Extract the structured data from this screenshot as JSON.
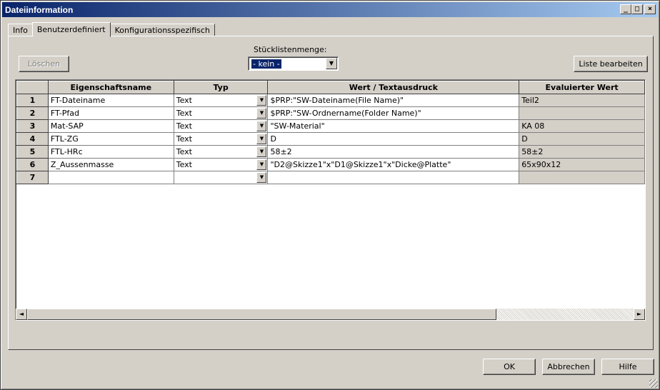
{
  "window": {
    "title": "Dateiinformation",
    "buttons": {
      "minimize": "_",
      "maximize": "□",
      "close": "×"
    }
  },
  "tabs": [
    {
      "label": "Info",
      "active": false
    },
    {
      "label": "Benutzerdefiniert",
      "active": true
    },
    {
      "label": "Konfigurationsspezifisch",
      "active": false
    }
  ],
  "toolbar": {
    "delete_label": "Löschen",
    "edit_list_label": "Liste bearbeiten"
  },
  "bom": {
    "label": "Stücklistenmenge:",
    "value": "- kein -"
  },
  "grid": {
    "headers": [
      "Eigenschaftsname",
      "Typ",
      "Wert / Textausdruck",
      "Evaluierter Wert"
    ],
    "rows": [
      {
        "num": "1",
        "name": "FT-Dateiname",
        "type": "Text",
        "value": "$PRP:\"SW-Dateiname(File Name)\"",
        "evaluated": "Teil2"
      },
      {
        "num": "2",
        "name": "FT-Pfad",
        "type": "Text",
        "value": "$PRP:\"SW-Ordnername(Folder Name)\"",
        "evaluated": ""
      },
      {
        "num": "3",
        "name": "Mat-SAP",
        "type": "Text",
        "value": "\"SW-Material\"",
        "evaluated": "KA 08"
      },
      {
        "num": "4",
        "name": "FTL-ZG",
        "type": "Text",
        "value": "D",
        "evaluated": "D"
      },
      {
        "num": "5",
        "name": "FTL-HRc",
        "type": "Text",
        "value": "58±2",
        "evaluated": "58±2"
      },
      {
        "num": "6",
        "name": "Z_Aussenmasse",
        "type": "Text",
        "value": "\"D2@Skizze1\"x\"D1@Skizze1\"x\"Dicke@Platte\"",
        "evaluated": "65x90x12"
      },
      {
        "num": "7",
        "name": "",
        "type": "",
        "value": "",
        "evaluated": ""
      }
    ]
  },
  "footer": {
    "ok_label": "OK",
    "cancel_label": "Abbrechen",
    "help_label": "Hilfe"
  }
}
